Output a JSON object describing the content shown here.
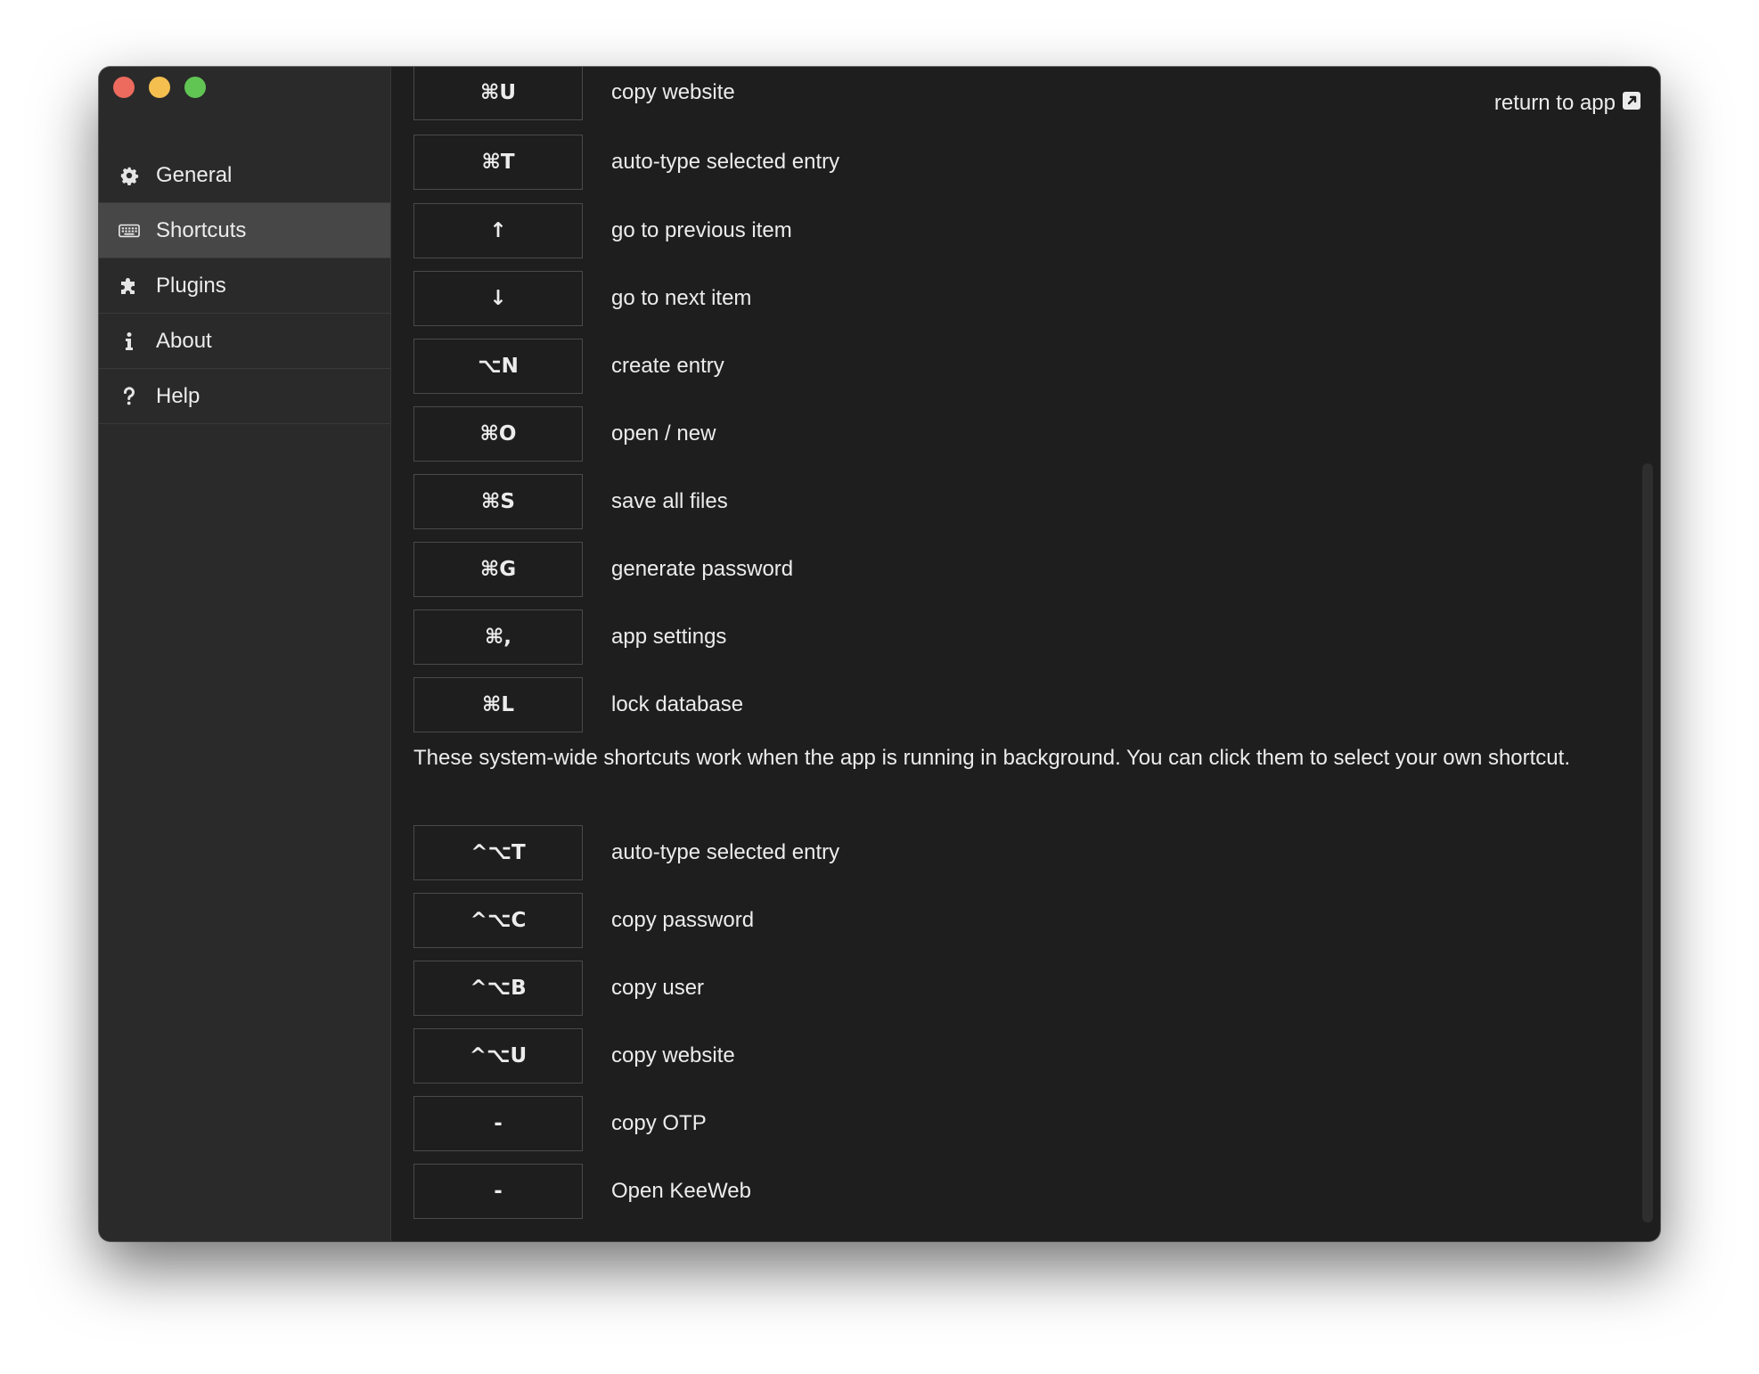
{
  "window": {
    "traffic_colors": {
      "close": "#ed6a5e",
      "minimize": "#f4bf4f",
      "maximize": "#61c554"
    }
  },
  "sidebar": {
    "items": [
      {
        "label": "General",
        "icon": "gear-icon"
      },
      {
        "label": "Shortcuts",
        "icon": "keyboard-icon",
        "active": true
      },
      {
        "label": "Plugins",
        "icon": "puzzle-icon"
      },
      {
        "label": "About",
        "icon": "info-icon"
      },
      {
        "label": "Help",
        "icon": "question-icon"
      }
    ]
  },
  "header": {
    "return_label": "return to app",
    "return_icon": "external-link-icon"
  },
  "shortcuts": [
    {
      "key": "⌘U",
      "desc": "copy website"
    },
    {
      "key": "⌘T",
      "desc": "auto-type selected entry"
    },
    {
      "key": "↑",
      "desc": "go to previous item"
    },
    {
      "key": "↓",
      "desc": "go to next item"
    },
    {
      "key": "⌥N",
      "desc": "create entry"
    },
    {
      "key": "⌘O",
      "desc": "open / new"
    },
    {
      "key": "⌘S",
      "desc": "save all files"
    },
    {
      "key": "⌘G",
      "desc": "generate password"
    },
    {
      "key": "⌘,",
      "desc": "app settings"
    },
    {
      "key": "⌘L",
      "desc": "lock database"
    }
  ],
  "global_note": "These system-wide shortcuts work when the app is running in background. You can click them to select your own shortcut.",
  "global_shortcuts": [
    {
      "key": "^⌥T",
      "desc": "auto-type selected entry"
    },
    {
      "key": "^⌥C",
      "desc": "copy password"
    },
    {
      "key": "^⌥B",
      "desc": "copy user"
    },
    {
      "key": "^⌥U",
      "desc": "copy website"
    },
    {
      "key": "-",
      "desc": "copy OTP"
    },
    {
      "key": "-",
      "desc": "Open KeeWeb"
    }
  ]
}
